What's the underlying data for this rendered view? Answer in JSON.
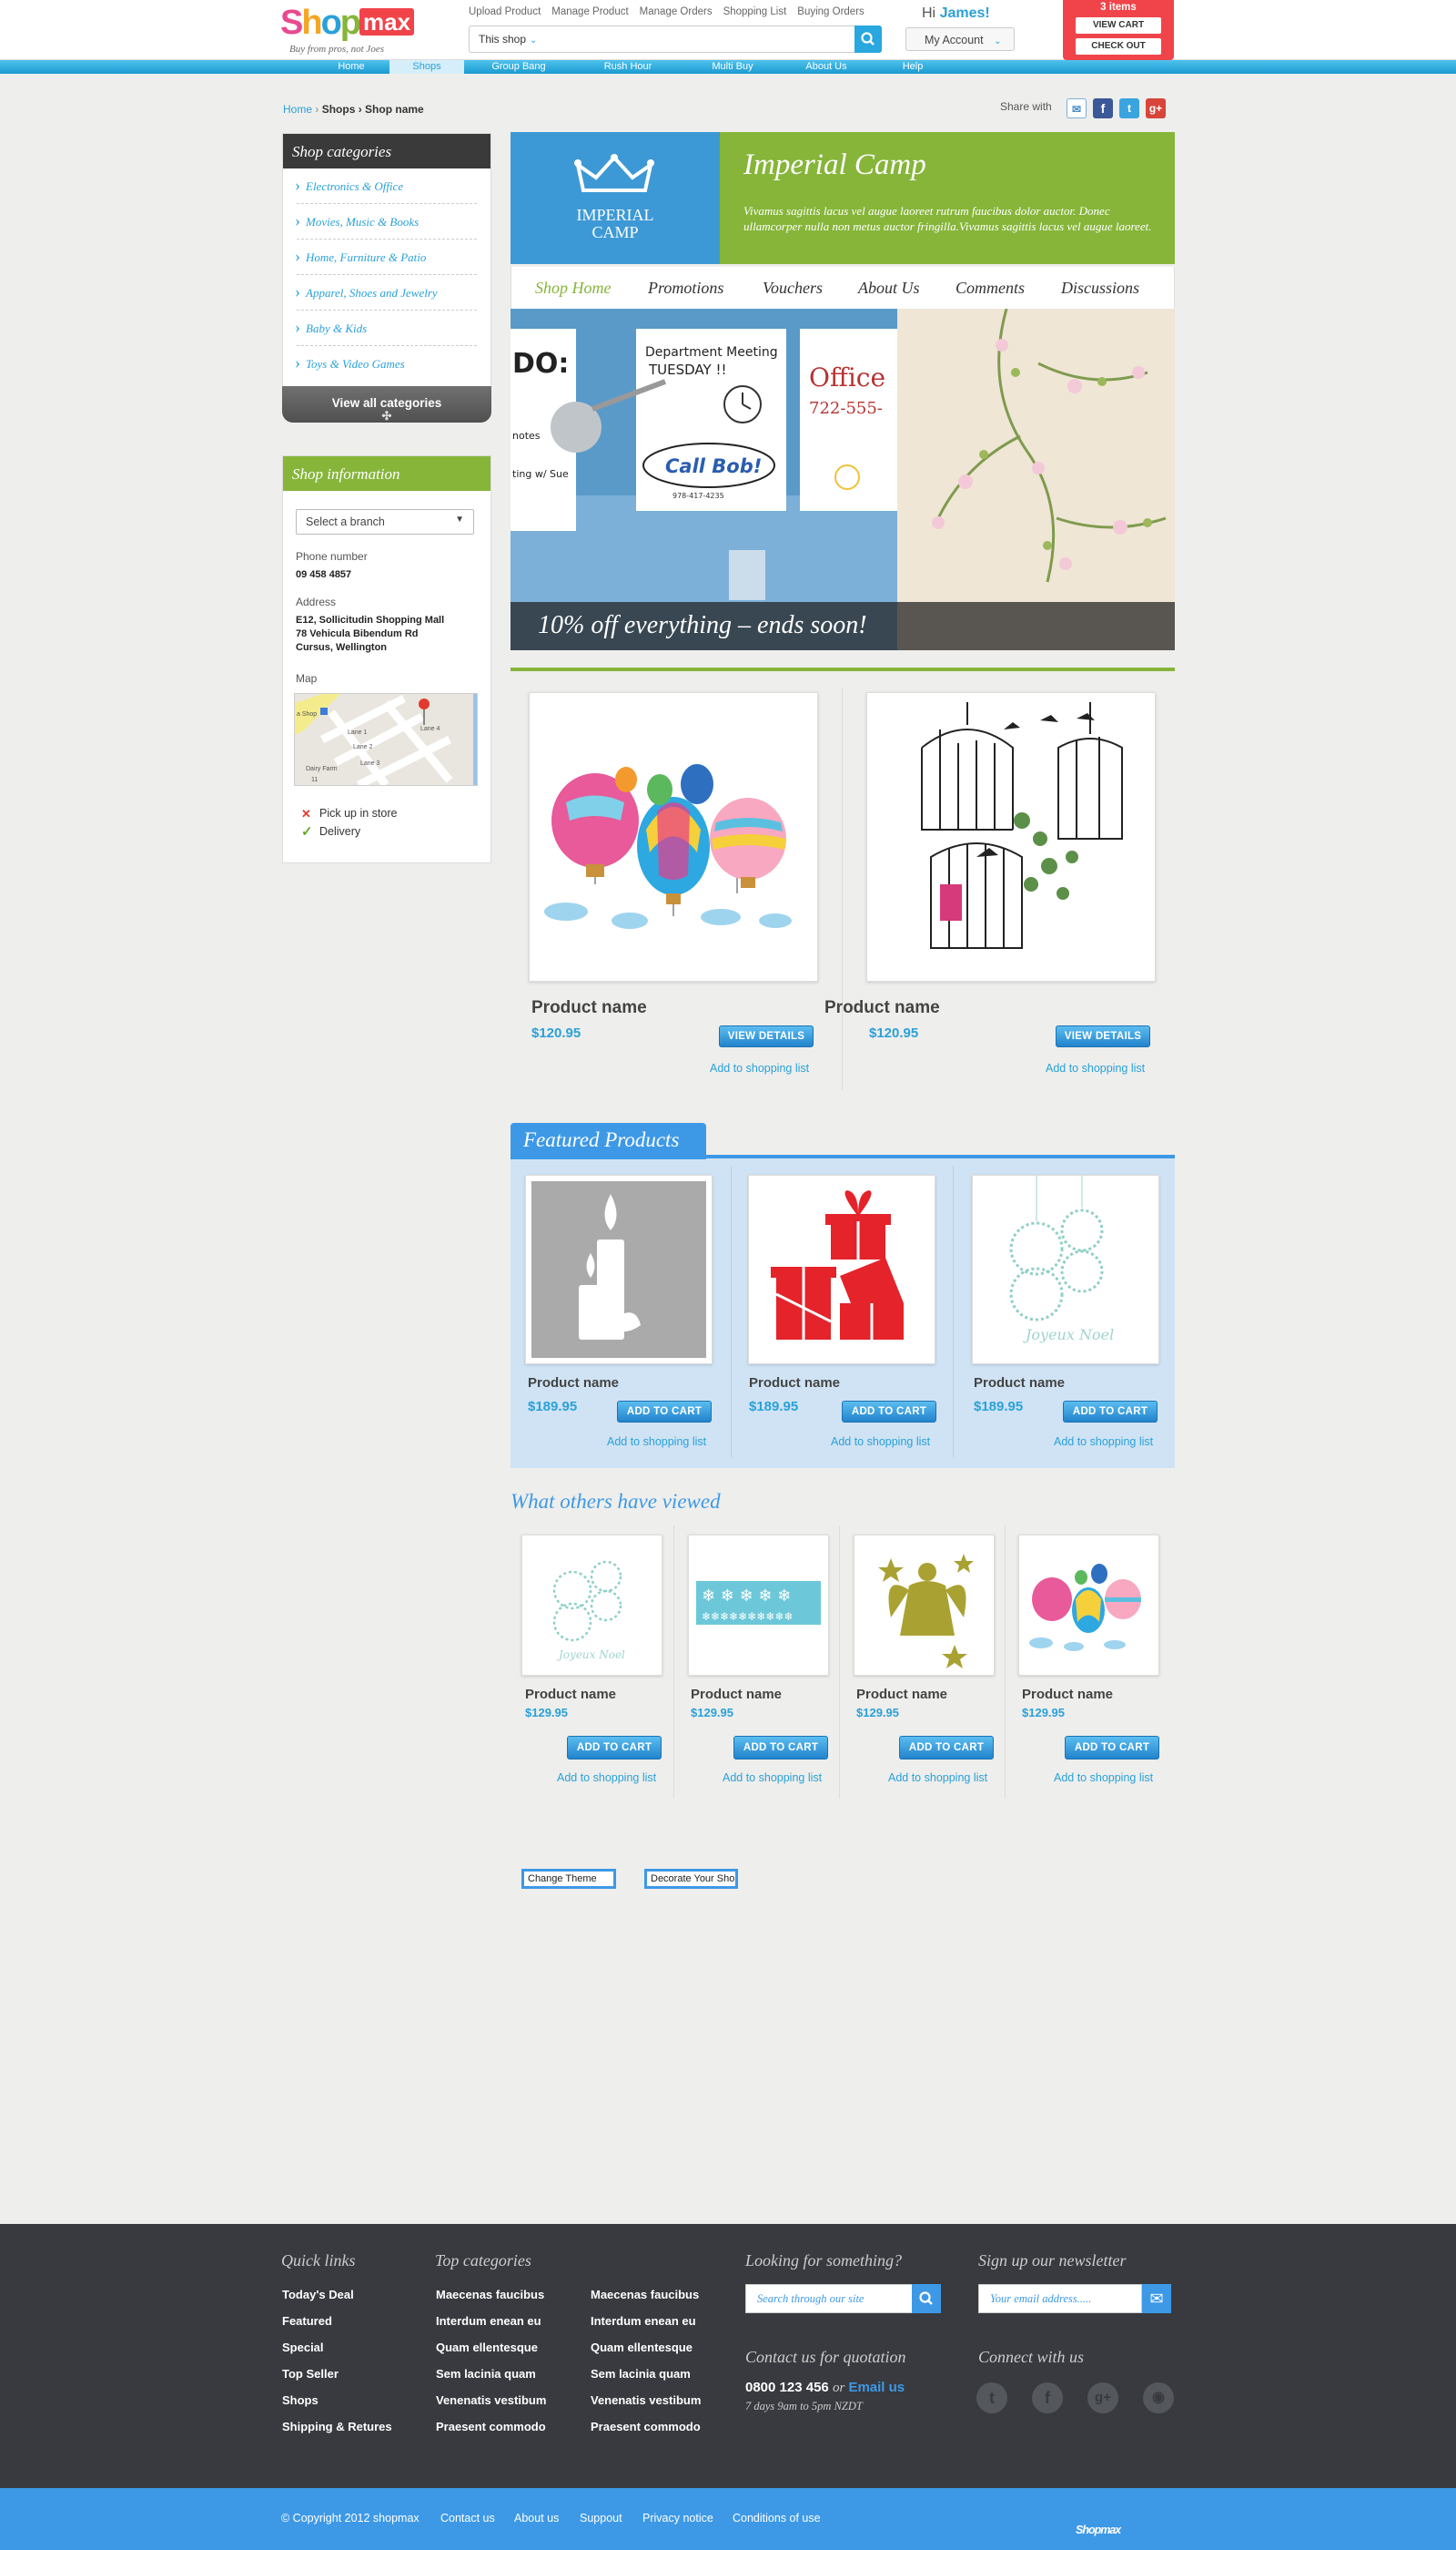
{
  "header": {
    "logo": {
      "text": "Shopmax",
      "tagline": "Buy from pros, not Joes"
    },
    "top_links": [
      "Upload Product",
      "Manage Product",
      "Manage Orders",
      "Shopping List",
      "Buying Orders"
    ],
    "search_scope": "This shop",
    "greeting": "Hi",
    "user_name": "James!",
    "account_label": "My Account",
    "cart": {
      "count_label": "3 items",
      "view_cart": "VIEW CART",
      "checkout": "CHECK OUT"
    }
  },
  "nav": [
    "Home",
    "Shops",
    "Group Bang",
    "Rush Hour",
    "Multi Buy",
    "About Us",
    "Help"
  ],
  "nav_active": "Shops",
  "breadcrumb": {
    "home": "Home",
    "rest": "Shops › Shop name"
  },
  "share": {
    "label": "Share with",
    "networks": [
      "email-icon",
      "facebook-icon",
      "twitter-icon",
      "google-plus-icon"
    ]
  },
  "categories": {
    "title": "Shop categories",
    "items": [
      "Electronics & Office",
      "Movies, Music & Books",
      "Home, Furniture & Patio",
      "Apparel, Shoes and Jewelry",
      "Baby & Kids",
      "Toys & Video Games"
    ],
    "view_all": "View all categories"
  },
  "shop_info": {
    "title": "Shop information",
    "branch_placeholder": "Select a branch",
    "phone_label": "Phone number",
    "phone": "09 458 4857",
    "address_label": "Address",
    "address_lines": [
      "E12, Sollicitudin Shopping Mall",
      "78 Vehicula Bibendum Rd",
      "Cursus, Wellington"
    ],
    "map_label": "Map",
    "pickup": "Pick up in store",
    "delivery": "Delivery"
  },
  "shop": {
    "name": "Imperial Camp",
    "logo_text": [
      "IMPERIAL",
      "CAMP"
    ],
    "description": "Vivamus sagittis lacus vel augue laoreet rutrum faucibus dolor auctor. Donec ullamcorper nulla non metus auctor fringilla.Vivamus sagittis lacus vel augue laoreet.",
    "tabs": [
      "Shop Home",
      "Promotions",
      "Vouchers",
      "About Us",
      "Comments",
      "Discussions"
    ],
    "active_tab": "Shop Home",
    "promo": "10% off everything – ends soon!"
  },
  "products": [
    {
      "name": "Product name",
      "price": "$120.95",
      "button": "VIEW DETAILS",
      "list": "Add to shopping list",
      "image": "balloons"
    },
    {
      "name": "Product name",
      "price": "$120.95",
      "button": "VIEW DETAILS",
      "list": "Add to shopping list",
      "image": "birdcages"
    }
  ],
  "featured": {
    "title": "Featured Products",
    "items": [
      {
        "name": "Product name",
        "price": "$189.95",
        "button": "ADD TO CART",
        "list": "Add to shopping list",
        "image": "candles"
      },
      {
        "name": "Product name",
        "price": "$189.95",
        "button": "ADD TO CART",
        "list": "Add to shopping list",
        "image": "gifts"
      },
      {
        "name": "Product name",
        "price": "$189.95",
        "button": "ADD TO CART",
        "list": "Add to shopping list",
        "image": "ornaments"
      }
    ]
  },
  "others": {
    "title": "What others have viewed",
    "items": [
      {
        "name": "Product name",
        "price": "$129.95",
        "button": "ADD TO CART",
        "list": "Add to shopping list",
        "image": "ornaments"
      },
      {
        "name": "Product name",
        "price": "$129.95",
        "button": "ADD TO CART",
        "list": "Add to shopping list",
        "image": "snowflakes"
      },
      {
        "name": "Product name",
        "price": "$129.95",
        "button": "ADD TO CART",
        "list": "Add to shopping list",
        "image": "angel"
      },
      {
        "name": "Product name",
        "price": "$129.95",
        "button": "ADD TO CART",
        "list": "Add to shopping list",
        "image": "balloons"
      }
    ]
  },
  "theme_buttons": [
    "Change Theme",
    "Decorate Your Shop"
  ],
  "footer": {
    "quick_links_title": "Quick links",
    "quick_links": [
      "Today's Deal",
      "Featured",
      "Special",
      "Top Seller",
      "Shops",
      "Shipping & Retures"
    ],
    "top_categories_title": "Top categories",
    "top_categories_col1": [
      "Maecenas faucibus",
      "Interdum enean eu",
      "Quam ellentesque",
      "Sem lacinia quam",
      "Venenatis vestibum",
      "Praesent commodo"
    ],
    "top_categories_col2": [
      "Maecenas faucibus",
      "Interdum enean eu",
      "Quam ellentesque",
      "Sem lacinia quam",
      "Venenatis vestibum",
      "Praesent commodo"
    ],
    "search_title": "Looking for something?",
    "search_placeholder": "Search through our site",
    "newsletter_title": "Sign up our newsletter",
    "newsletter_placeholder": "Your email address.....",
    "contact_title": "Contact us for quotation",
    "phone": "0800 123 456",
    "or": "or",
    "email_link": "Email us",
    "hours": "7 days 9am to 5pm NZDT",
    "connect_title": "Connect with us",
    "social": [
      "twitter-icon",
      "facebook-icon",
      "google-plus-icon",
      "rss-icon"
    ]
  },
  "bottom": {
    "copyright": "© Copyright 2012 shopmax",
    "links": [
      "Contact us",
      "About us",
      "Suppout",
      "Privacy notice",
      "Conditions of use"
    ],
    "logo": "Shopmax"
  },
  "colors": {
    "accent_blue": "#3d99e6",
    "header_blue": "#29a7df",
    "green": "#86b53a",
    "cart_red": "#f0444a",
    "footer_dark": "#383a3f"
  }
}
